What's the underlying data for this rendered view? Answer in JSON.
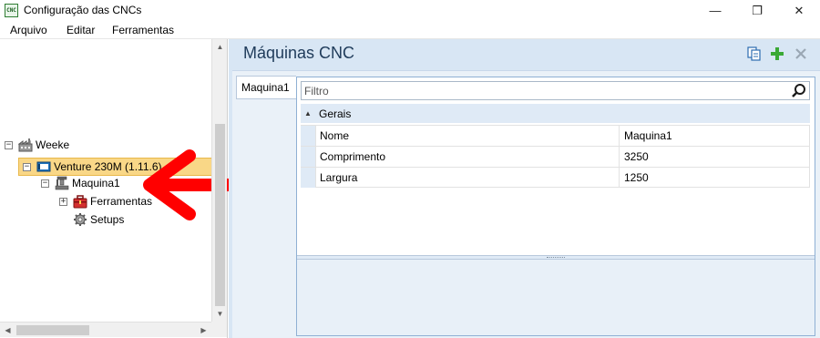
{
  "window": {
    "title": "Configuração das CNCs",
    "app_icon_text": "CNC",
    "minimize_glyph": "—",
    "maximize_glyph": "❐",
    "close_glyph": "✕"
  },
  "menu": {
    "items": [
      "Arquivo",
      "Editar",
      "Ferramentas"
    ]
  },
  "tree": {
    "nodes": [
      {
        "label": "Weeke",
        "icon": "factory-icon",
        "expander": "−"
      },
      {
        "label": "Venture 230M (1.11.6)",
        "icon": "cnc-machine-icon",
        "expander": "−",
        "selected": true
      },
      {
        "label": "Maquina1",
        "icon": "machine-tool-icon",
        "expander": "−"
      },
      {
        "label": "Ferramentas",
        "icon": "toolbox-icon",
        "expander": "+"
      },
      {
        "label": "Setups",
        "icon": "gear-icon"
      }
    ]
  },
  "main": {
    "title": "Máquinas CNC",
    "tab_label": "Maquina1",
    "filter_placeholder": "Filtro",
    "group": {
      "label": "Gerais",
      "collapse_glyph": "▲"
    },
    "properties": [
      {
        "name": "Nome",
        "value": "Maquina1"
      },
      {
        "name": "Comprimento",
        "value": "3250"
      },
      {
        "name": "Largura",
        "value": "1250"
      }
    ]
  },
  "colors": {
    "selection": "#f9d787",
    "header_bg": "#d8e6f4",
    "arrow_annotation": "#ff0000",
    "add_icon": "#3aa935"
  }
}
